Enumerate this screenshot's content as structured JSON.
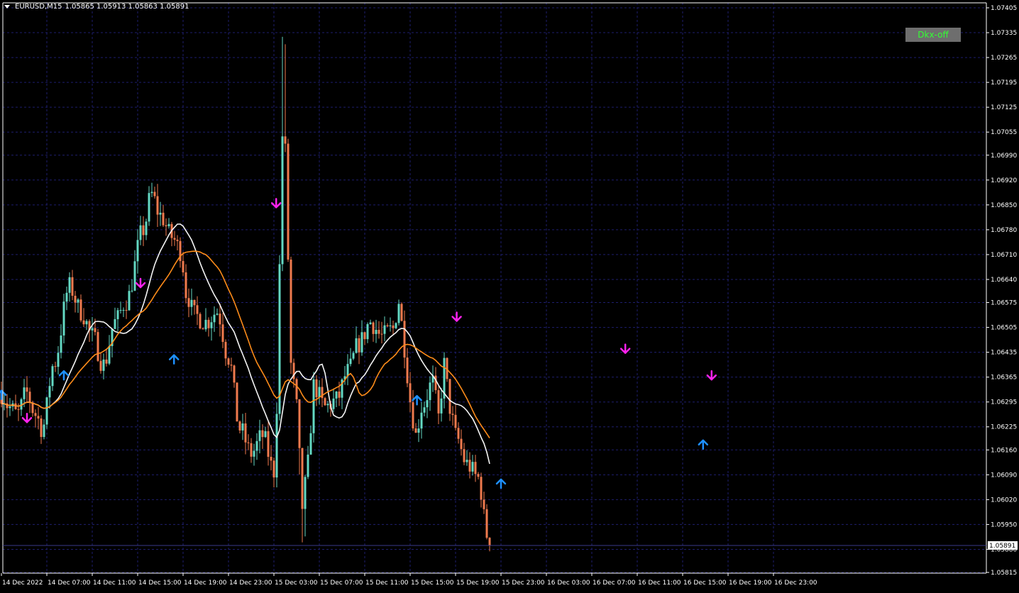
{
  "header": {
    "symbol": "EURUSD,M15",
    "ohlc": "1.05865 1.05913 1.05863 1.05891"
  },
  "dkx_button": {
    "label": "Dkx-off"
  },
  "current_price": "1.05891",
  "colors": {
    "background": "#000000",
    "grid": "#1e1e6e",
    "axis": "#ffffff",
    "bull_candle": "#63d9c3",
    "bear_candle": "#ef7a4e",
    "ma_fast": "#f4f4f4",
    "ma_slow": "#ff8c1a",
    "sell_arrow": "#ff22ee",
    "buy_arrow": "#1e90ff"
  },
  "chart_data": {
    "type": "candlestick",
    "symbol": "EURUSD",
    "timeframe": "M15",
    "ylim": [
      1.05815,
      1.07405
    ],
    "y_ticks": [
      "1.07405",
      "1.07335",
      "1.07265",
      "1.07195",
      "1.07125",
      "1.07055",
      "1.06990",
      "1.06920",
      "1.06850",
      "1.06780",
      "1.06710",
      "1.06640",
      "1.06575",
      "1.06505",
      "1.06435",
      "1.06365",
      "1.06295",
      "1.06225",
      "1.06160",
      "1.06090",
      "1.06020",
      "1.05950",
      "1.05880",
      "1.05815"
    ],
    "x_ticks": [
      "14 Dec 2022",
      "14 Dec 07:00",
      "14 Dec 11:00",
      "14 Dec 15:00",
      "14 Dec 19:00",
      "14 Dec 23:00",
      "15 Dec 03:00",
      "15 Dec 07:00",
      "15 Dec 11:00",
      "15 Dec 15:00",
      "15 Dec 19:00",
      "15 Dec 23:00",
      "16 Dec 03:00",
      "16 Dec 07:00",
      "16 Dec 11:00",
      "16 Dec 15:00",
      "16 Dec 19:00",
      "16 Dec 23:00"
    ],
    "bar_hours": 0.25,
    "price_anchors": [
      [
        0,
        1.0632
      ],
      [
        0.7,
        1.0628
      ],
      [
        1.4,
        1.0626
      ],
      [
        2.2,
        1.0632
      ],
      [
        3.0,
        1.0626
      ],
      [
        3.6,
        1.0622
      ],
      [
        4.6,
        1.064
      ],
      [
        6.0,
        1.0662
      ],
      [
        7.0,
        1.0655
      ],
      [
        8.0,
        1.0648
      ],
      [
        9.0,
        1.064
      ],
      [
        10.0,
        1.0652
      ],
      [
        11.0,
        1.0658
      ],
      [
        12.5,
        1.0678
      ],
      [
        13.2,
        1.0688
      ],
      [
        14.0,
        1.0682
      ],
      [
        15.0,
        1.0676
      ],
      [
        15.8,
        1.0672
      ],
      [
        16.3,
        1.066
      ],
      [
        17.0,
        1.0654
      ],
      [
        18.0,
        1.0652
      ],
      [
        19.0,
        1.0655
      ],
      [
        20.0,
        1.0642
      ],
      [
        21.0,
        1.0622
      ],
      [
        22.0,
        1.0615
      ],
      [
        23.0,
        1.062
      ],
      [
        24.0,
        1.061
      ],
      [
        24.3,
        1.063
      ],
      [
        24.7,
        1.0705
      ],
      [
        25.0,
        1.07
      ],
      [
        25.5,
        1.064
      ],
      [
        26.0,
        1.0628
      ],
      [
        26.5,
        1.06
      ],
      [
        27.0,
        1.0612
      ],
      [
        27.5,
        1.0634
      ],
      [
        28.5,
        1.0628
      ],
      [
        29.5,
        1.063
      ],
      [
        30.5,
        1.0638
      ],
      [
        31.5,
        1.0646
      ],
      [
        32.5,
        1.0652
      ],
      [
        33.5,
        1.0648
      ],
      [
        34.5,
        1.065
      ],
      [
        35.0,
        1.0658
      ],
      [
        35.5,
        1.0645
      ],
      [
        36.0,
        1.063
      ],
      [
        36.5,
        1.062
      ],
      [
        37.0,
        1.0628
      ],
      [
        38.0,
        1.0635
      ],
      [
        38.5,
        1.0625
      ],
      [
        39.0,
        1.064
      ],
      [
        39.5,
        1.0628
      ],
      [
        40.0,
        1.062
      ],
      [
        41.0,
        1.0612
      ],
      [
        42.0,
        1.0608
      ],
      [
        42.8,
        1.0592
      ],
      [
        43.0,
        1.0589
      ]
    ],
    "series": [
      {
        "name": "",
        "type": "line",
        "smoothing": 16,
        "color": "#f4f4f4"
      },
      {
        "name": "",
        "type": "line",
        "smoothing": 26,
        "color": "#ff8c1a"
      }
    ],
    "signals": [
      {
        "type": "buy",
        "time_h": 0.0,
        "price": 1.06315
      },
      {
        "type": "sell",
        "time_h": 2.25,
        "price": 1.0625
      },
      {
        "type": "buy",
        "time_h": 5.5,
        "price": 1.0637
      },
      {
        "type": "sell",
        "time_h": 12.25,
        "price": 1.0663
      },
      {
        "type": "buy",
        "time_h": 15.2,
        "price": 1.06415
      },
      {
        "type": "sell",
        "time_h": 24.2,
        "price": 1.06855
      },
      {
        "type": "buy",
        "time_h": 36.6,
        "price": 1.063
      },
      {
        "type": "sell",
        "time_h": 40.1,
        "price": 1.06535
      },
      {
        "type": "buy",
        "time_h": 44.0,
        "price": 1.06065
      },
      {
        "type": "sell",
        "time_h": 54.95,
        "price": 1.06445
      },
      {
        "type": "buy",
        "time_h": 61.8,
        "price": 1.06175
      },
      {
        "type": "sell",
        "time_h": 62.55,
        "price": 1.0637
      }
    ]
  }
}
